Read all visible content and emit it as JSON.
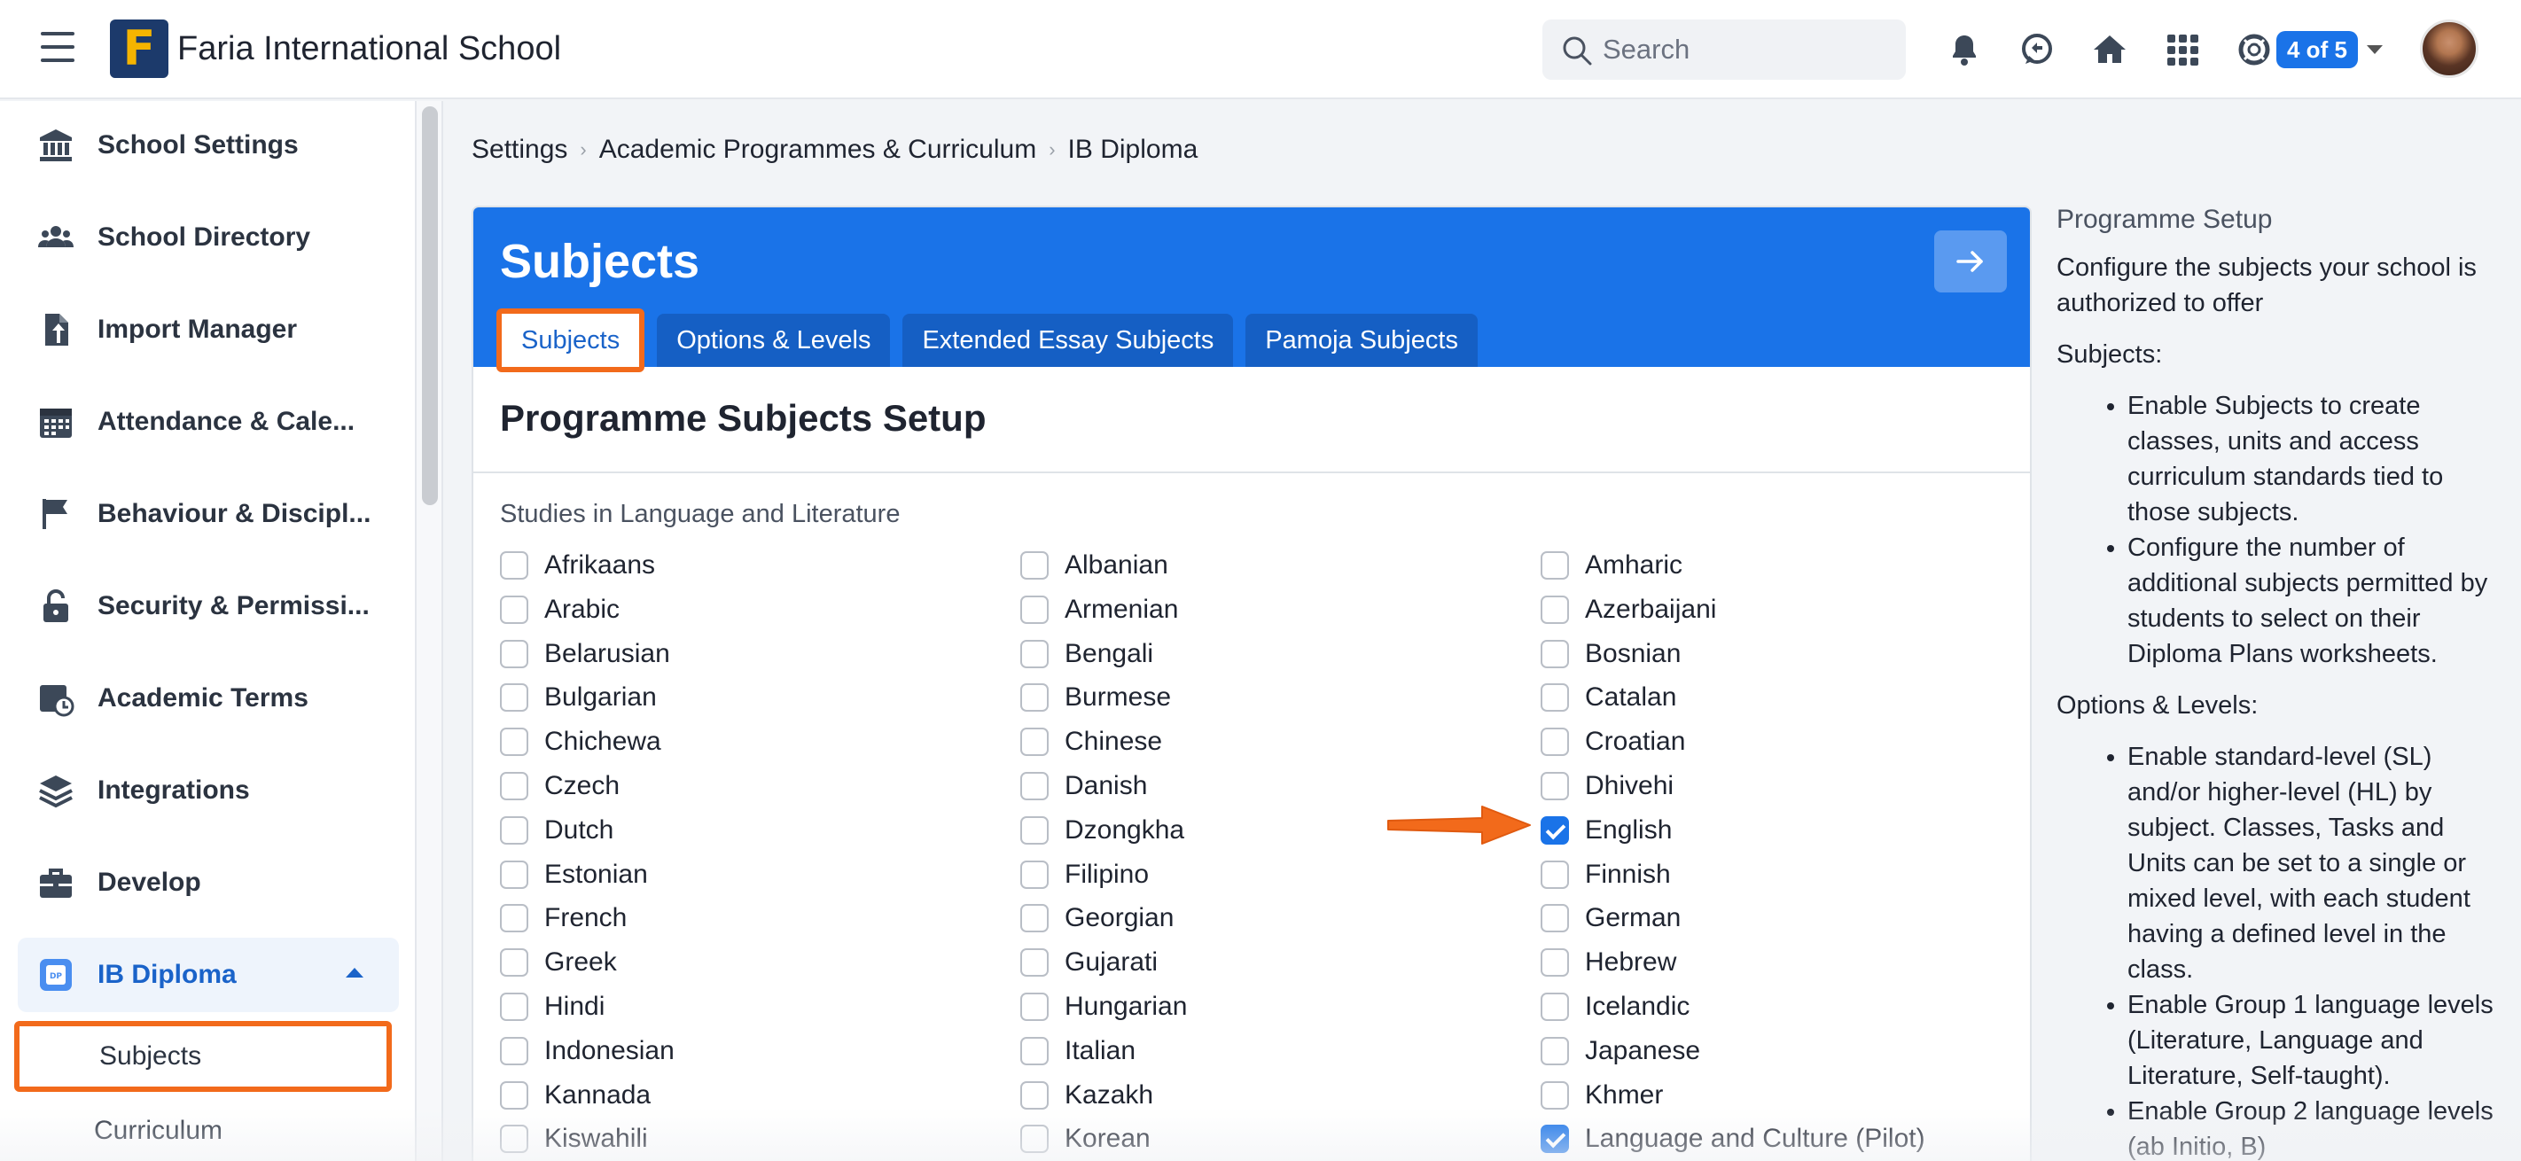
{
  "topbar": {
    "school_name": "Faria International School",
    "logo_letter": "F",
    "search_placeholder": "Search",
    "badge_text": "4 of 5",
    "icons": [
      "bell-icon",
      "chat-icon",
      "home-icon",
      "apps-grid-icon",
      "lifebuoy-icon"
    ]
  },
  "sidebar": {
    "items": [
      {
        "label": "School Settings",
        "icon": "bank-icon"
      },
      {
        "label": "School Directory",
        "icon": "people-icon"
      },
      {
        "label": "Import Manager",
        "icon": "file-import-icon"
      },
      {
        "label": "Attendance & Cale...",
        "icon": "calendar-icon"
      },
      {
        "label": "Behaviour & Discipl...",
        "icon": "flag-icon"
      },
      {
        "label": "Security & Permissi...",
        "icon": "lock-icon"
      },
      {
        "label": "Academic Terms",
        "icon": "calendar-clock-icon"
      },
      {
        "label": "Integrations",
        "icon": "layers-icon"
      },
      {
        "label": "Develop",
        "icon": "briefcase-icon"
      }
    ],
    "active_section": {
      "label": "IB Diploma",
      "icon": "dp-icon"
    },
    "subitems": [
      {
        "label": "Subjects",
        "current": true
      },
      {
        "label": "Curriculum",
        "current": false
      }
    ]
  },
  "breadcrumb": [
    "Settings",
    "Academic Programmes & Curriculum",
    "IB Diploma"
  ],
  "card": {
    "title": "Subjects",
    "tabs": [
      {
        "label": "Subjects",
        "active": true
      },
      {
        "label": "Options & Levels",
        "active": false
      },
      {
        "label": "Extended Essay Subjects",
        "active": false
      },
      {
        "label": "Pamoja Subjects",
        "active": false
      }
    ],
    "subtitle": "Programme Subjects Setup",
    "section_label": "Studies in Language and Literature",
    "columns": [
      [
        {
          "label": "Afrikaans",
          "checked": false
        },
        {
          "label": "Arabic",
          "checked": false
        },
        {
          "label": "Belarusian",
          "checked": false
        },
        {
          "label": "Bulgarian",
          "checked": false
        },
        {
          "label": "Chichewa",
          "checked": false
        },
        {
          "label": "Czech",
          "checked": false
        },
        {
          "label": "Dutch",
          "checked": false
        },
        {
          "label": "Estonian",
          "checked": false
        },
        {
          "label": "French",
          "checked": false
        },
        {
          "label": "Greek",
          "checked": false
        },
        {
          "label": "Hindi",
          "checked": false
        },
        {
          "label": "Indonesian",
          "checked": false
        },
        {
          "label": "Kannada",
          "checked": false
        },
        {
          "label": "Kiswahili",
          "checked": false
        }
      ],
      [
        {
          "label": "Albanian",
          "checked": false
        },
        {
          "label": "Armenian",
          "checked": false
        },
        {
          "label": "Bengali",
          "checked": false
        },
        {
          "label": "Burmese",
          "checked": false
        },
        {
          "label": "Chinese",
          "checked": false
        },
        {
          "label": "Danish",
          "checked": false
        },
        {
          "label": "Dzongkha",
          "checked": false
        },
        {
          "label": "Filipino",
          "checked": false
        },
        {
          "label": "Georgian",
          "checked": false
        },
        {
          "label": "Gujarati",
          "checked": false
        },
        {
          "label": "Hungarian",
          "checked": false
        },
        {
          "label": "Italian",
          "checked": false
        },
        {
          "label": "Kazakh",
          "checked": false
        },
        {
          "label": "Korean",
          "checked": false
        }
      ],
      [
        {
          "label": "Amharic",
          "checked": false
        },
        {
          "label": "Azerbaijani",
          "checked": false
        },
        {
          "label": "Bosnian",
          "checked": false
        },
        {
          "label": "Catalan",
          "checked": false
        },
        {
          "label": "Croatian",
          "checked": false
        },
        {
          "label": "Dhivehi",
          "checked": false
        },
        {
          "label": "English",
          "checked": true
        },
        {
          "label": "Finnish",
          "checked": false
        },
        {
          "label": "German",
          "checked": false
        },
        {
          "label": "Hebrew",
          "checked": false
        },
        {
          "label": "Icelandic",
          "checked": false
        },
        {
          "label": "Japanese",
          "checked": false
        },
        {
          "label": "Khmer",
          "checked": false
        },
        {
          "label": "Language and Culture (Pilot)",
          "checked": true
        }
      ]
    ]
  },
  "help": {
    "title": "Programme Setup",
    "intro": "Configure the subjects your school is authorized to offer",
    "subjects_heading": "Subjects:",
    "subjects_points": [
      "Enable Subjects to create classes, units and access curriculum standards tied to those subjects.",
      "Configure the number of additional subjects permitted by students to select on their Diploma Plans worksheets."
    ],
    "options_heading": "Options & Levels:",
    "options_points": [
      "Enable standard-level (SL) and/or higher-level (HL) by subject. Classes, Tasks and Units can be set to a single or mixed level, with each student having a defined level in the class.",
      "Enable Group 1 language levels (Literature, Language and Literature, Self-taught).",
      "Enable Group 2 language levels (ab Initio, B)"
    ]
  },
  "colors": {
    "primary": "#1a73e8",
    "highlight": "#f26a1b",
    "logo_bg": "#1c3a6b",
    "logo_fg": "#f5b400"
  }
}
